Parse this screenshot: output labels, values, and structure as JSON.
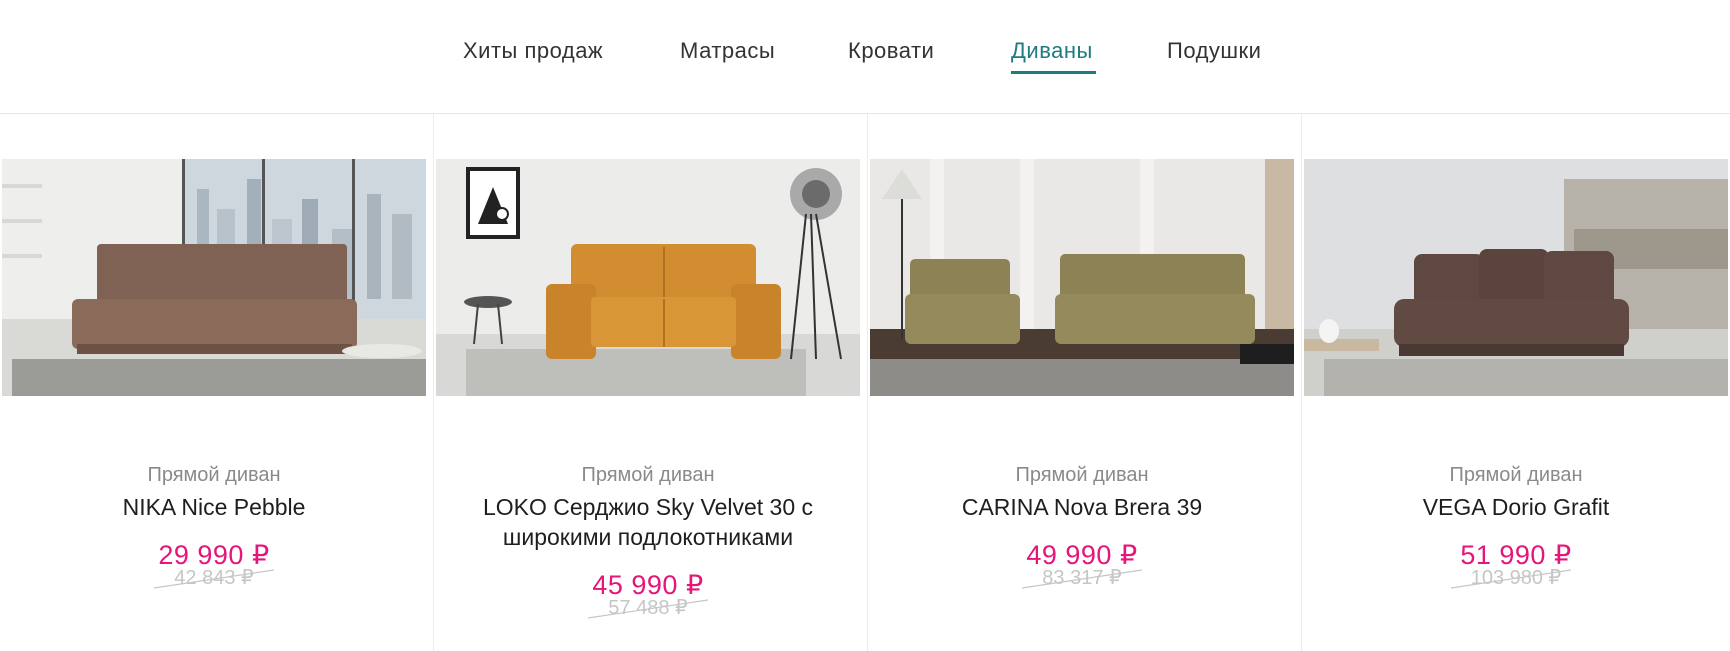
{
  "tabs": [
    {
      "label": "Хиты продаж",
      "active": false
    },
    {
      "label": "Матрасы",
      "active": false
    },
    {
      "label": "Кровати",
      "active": false
    },
    {
      "label": "Диваны",
      "active": true
    },
    {
      "label": "Подушки",
      "active": false
    }
  ],
  "colors": {
    "accent": "#1d7c80",
    "price": "#e5157a",
    "old_price": "#c6c6c6",
    "product_type": "#8a8a8a"
  },
  "products": [
    {
      "type": "Прямой диван",
      "name": "NIKA Nice Pebble",
      "price": "29 990 ₽",
      "old_price": "42 843 ₽",
      "image": "brown-sofa-city-window"
    },
    {
      "type": "Прямой диван",
      "name": "LOKO Серджио Sky Velvet 30 с широкими подлокотниками",
      "price": "45 990 ₽",
      "old_price": "57 488 ₽",
      "image": "orange-sofa-floor-lamp"
    },
    {
      "type": "Прямой диван",
      "name": "CARINA Nova Brera 39",
      "price": "49 990 ₽",
      "old_price": "83 317 ₽",
      "image": "olive-sofa-and-armchair"
    },
    {
      "type": "Прямой диван",
      "name": "VEGA Dorio Grafit",
      "price": "51 990 ₽",
      "old_price": "103 980 ₽",
      "image": "dark-brown-sofa-pillows"
    }
  ]
}
